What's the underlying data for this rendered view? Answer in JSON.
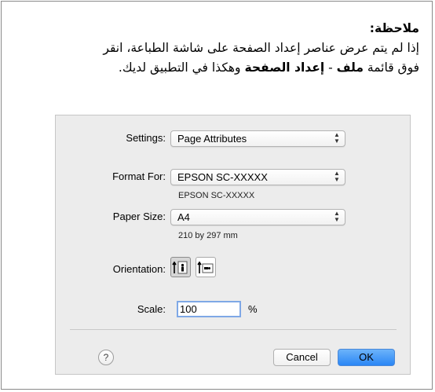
{
  "note": {
    "title": "ملاحظة:",
    "line1": "إذا لم يتم عرض عناصر إعداد الصفحة على شاشة الطباعة، انقر",
    "line2_prefix": "فوق قائمة ",
    "line2_file": "ملف",
    "line2_sep": " - ",
    "line2_pagesetup": "إعداد الصفحة",
    "line2_suffix": " وهكذا في التطبيق لديك."
  },
  "dialog": {
    "settings_label": "Settings:",
    "settings_value": "Page Attributes",
    "format_label": "Format For:",
    "format_value": "EPSON SC-XXXXX",
    "format_sub": "EPSON SC-XXXXX",
    "paper_label": "Paper Size:",
    "paper_value": "A4",
    "paper_sub": "210 by 297 mm",
    "orientation_label": "Orientation:",
    "scale_label": "Scale:",
    "scale_value": "100",
    "scale_unit": "%",
    "help": "?",
    "cancel": "Cancel",
    "ok": "OK"
  }
}
